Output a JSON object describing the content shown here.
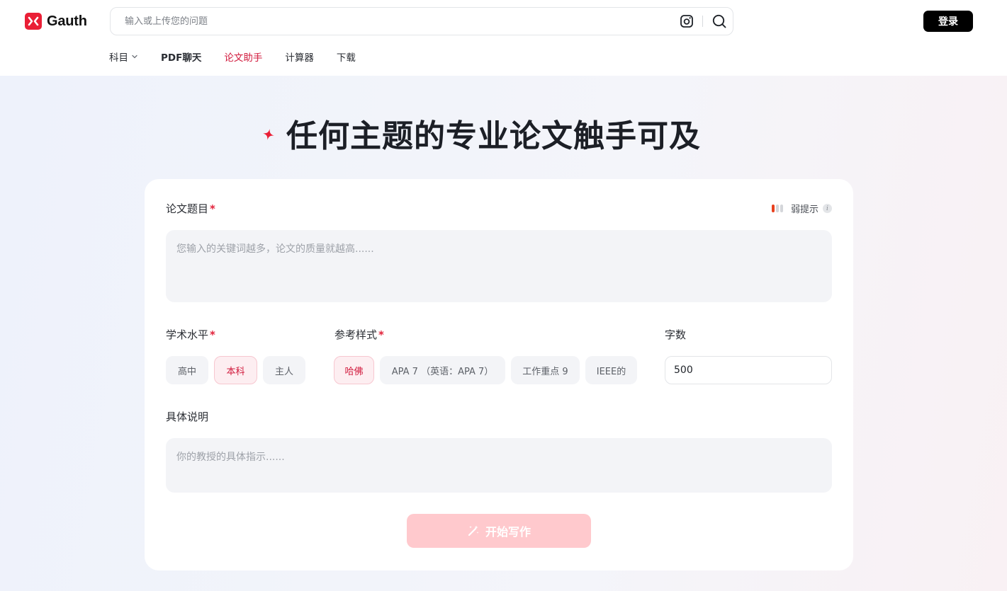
{
  "brand": {
    "name": "Gauth",
    "accent_color": "#ea1f36",
    "logo_icon": "gauth-x-icon"
  },
  "search": {
    "placeholder": "输入或上传您的问题",
    "camera_icon": "camera-icon",
    "search_icon": "search-icon"
  },
  "header": {
    "login_label": "登录"
  },
  "nav": {
    "items": [
      {
        "label": "科目",
        "has_dropdown": true,
        "active": false
      },
      {
        "label": "PDF聊天",
        "active": false
      },
      {
        "label": "论文助手",
        "active": true
      },
      {
        "label": "计算器",
        "active": false
      },
      {
        "label": "下载",
        "active": false
      }
    ]
  },
  "hero": {
    "title": "任何主题的专业论文触手可及",
    "icon": "sparkle-icon"
  },
  "form": {
    "topic": {
      "label": "论文题目",
      "required_mark": "*",
      "placeholder": "您输入的关键词越多，论文的质量就越高......",
      "hint_label": "弱提示",
      "hint_level": 1,
      "hint_max": 3
    },
    "level": {
      "label": "学术水平",
      "required_mark": "*",
      "options": [
        "高中",
        "本科",
        "主人"
      ],
      "selected": "本科"
    },
    "style": {
      "label": "参考样式",
      "required_mark": "*",
      "options": [
        "哈佛",
        "APA 7 （英语：APA 7）",
        "工作重点 9",
        "IEEE的"
      ],
      "selected": "哈佛"
    },
    "word_count": {
      "label": "字数",
      "value": "500"
    },
    "instructions": {
      "label": "具体说明",
      "placeholder": "你的教授的具体指示......"
    },
    "submit": {
      "label": "开始写作",
      "icon": "magic-wand-icon",
      "color": "#ffc9cd"
    }
  }
}
